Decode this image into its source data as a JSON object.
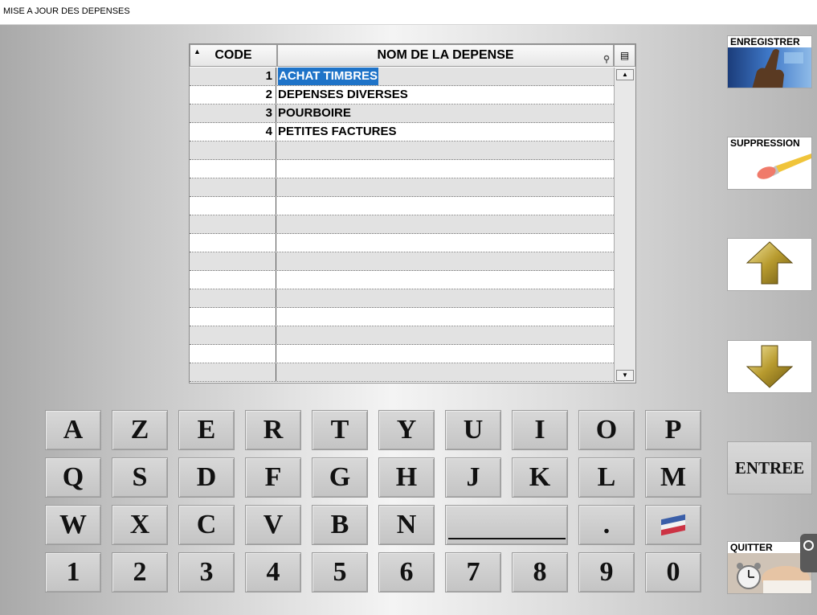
{
  "window": {
    "title": "MISE A JOUR DES DEPENSES"
  },
  "grid": {
    "columns": [
      "CODE",
      "NOM DE LA DEPENSE"
    ],
    "rows": [
      {
        "code": "1",
        "name": "ACHAT TIMBRES",
        "selected": true
      },
      {
        "code": "2",
        "name": "DEPENSES DIVERSES"
      },
      {
        "code": "3",
        "name": "POURBOIRE"
      },
      {
        "code": "4",
        "name": "PETITES FACTURES"
      },
      {
        "code": "",
        "name": ""
      },
      {
        "code": "",
        "name": ""
      },
      {
        "code": "",
        "name": ""
      },
      {
        "code": "",
        "name": ""
      },
      {
        "code": "",
        "name": ""
      },
      {
        "code": "",
        "name": ""
      },
      {
        "code": "",
        "name": ""
      },
      {
        "code": "",
        "name": ""
      },
      {
        "code": "",
        "name": ""
      },
      {
        "code": "",
        "name": ""
      },
      {
        "code": "",
        "name": ""
      },
      {
        "code": "",
        "name": ""
      },
      {
        "code": "",
        "name": ""
      }
    ],
    "selection_color": "#1e73c8"
  },
  "keyboard": {
    "row1": [
      "A",
      "Z",
      "E",
      "R",
      "T",
      "Y",
      "U",
      "I",
      "O",
      "P"
    ],
    "row2": [
      "Q",
      "S",
      "D",
      "F",
      "G",
      "H",
      "J",
      "K",
      "L",
      "M"
    ],
    "row3": [
      "W",
      "X",
      "C",
      "V",
      "B",
      "N"
    ],
    "dot": ".",
    "row4": [
      "1",
      "2",
      "3",
      "4",
      "5",
      "6",
      "7",
      "8",
      "9",
      "0"
    ],
    "flag_icon": "us-flag-icon"
  },
  "side": {
    "enregistrer": "ENREGISTRER",
    "suppression": "SUPPRESSION",
    "up_icon": "arrow-up-icon",
    "down_icon": "arrow-down-icon",
    "entree": "ENTREE",
    "quitter": "QUITTER"
  }
}
